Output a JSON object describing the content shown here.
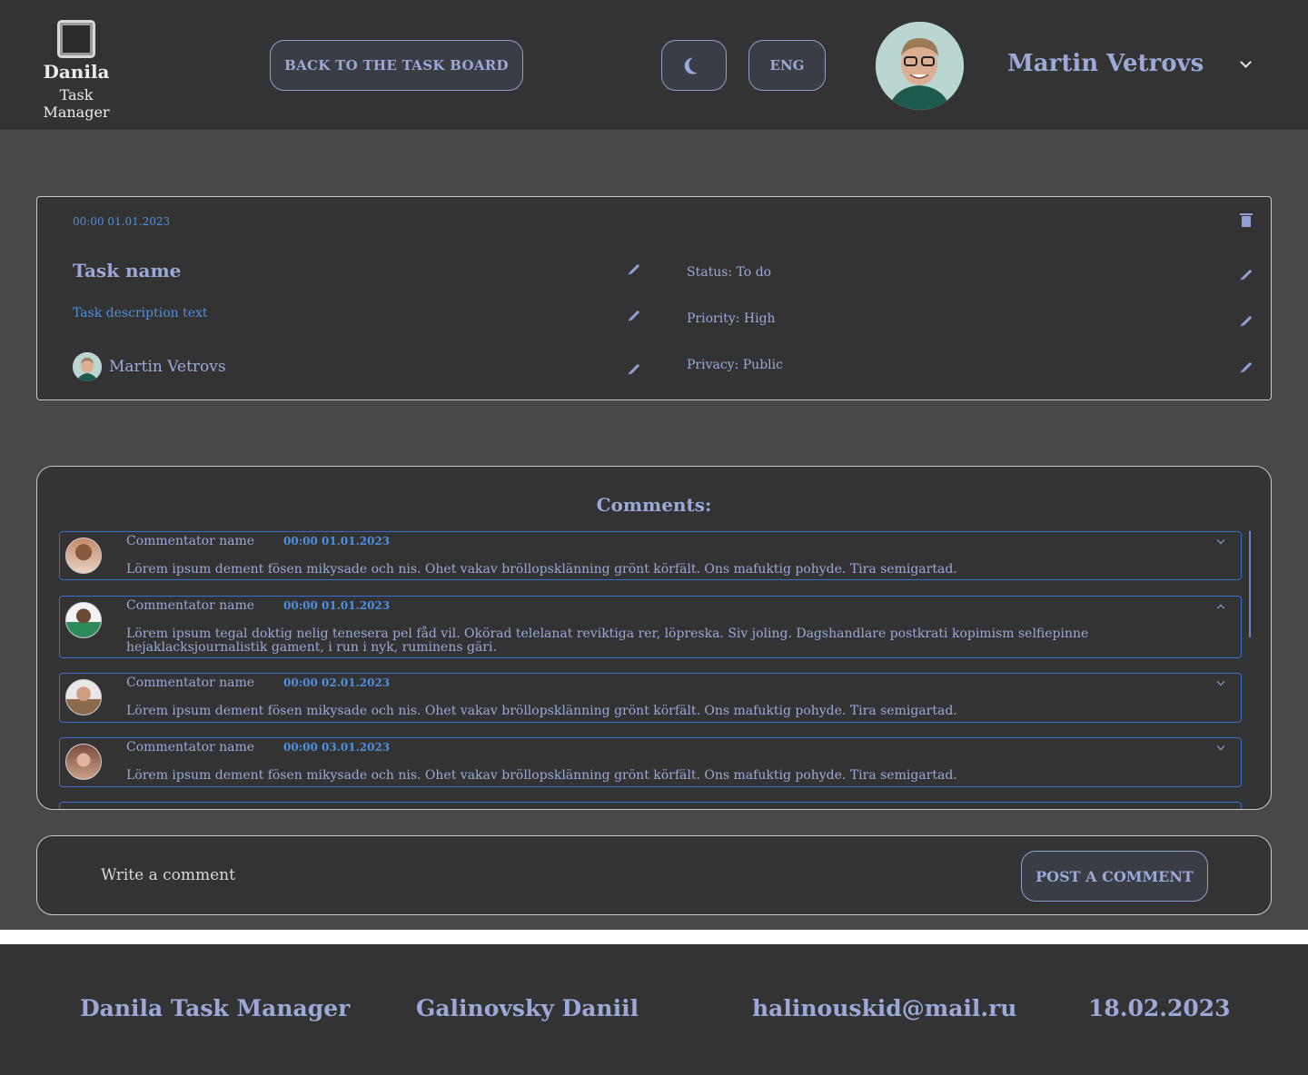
{
  "header": {
    "logo_name": "Danila",
    "logo_sub": "Task Manager",
    "back_label": "BACK TO THE TASK BOARD",
    "lang_label": "ENG",
    "user_name": "Martin Vetrovs"
  },
  "task": {
    "date": "00:00 01.01.2023",
    "name": "Task name",
    "description": "Task description text",
    "assignee": "Martin Vetrovs",
    "status": "Status: To do",
    "priority": "Priority: High",
    "privacy": "Privacy: Public"
  },
  "comments": {
    "title": "Comments:",
    "items": [
      {
        "name": "Commentator name",
        "date": "00:00 01.01.2023",
        "text": "Lörem ipsum dement fösen mikysade och nis. Ohet vakav bröllopsklänning grönt körfält. Ons mafuktig pohyde. Tira semigartad."
      },
      {
        "name": "Commentator name",
        "date": "00:00 01.01.2023",
        "text": "Lörem ipsum tegal doktig nelig tenesera pel fåd vil. Okörad telelanat reviktiga rer, löpreska. Siv joling. Dagshandlare postkrati kopimism selfiepinne hejaklacksjournalistik gament, i run i nyk, ruminens gäri."
      },
      {
        "name": "Commentator name",
        "date": "00:00 02.01.2023",
        "text": "Lörem ipsum dement fösen mikysade och nis. Ohet vakav bröllopsklänning grönt körfält. Ons mafuktig pohyde. Tira semigartad."
      },
      {
        "name": "Commentator name",
        "date": "00:00 03.01.2023",
        "text": "Lörem ipsum dement fösen mikysade och nis. Ohet vakav bröllopsklänning grönt körfält. Ons mafuktig pohyde. Tira semigartad."
      }
    ]
  },
  "write": {
    "placeholder": "Write a comment",
    "post_label": "POST A COMMENT"
  },
  "footer": {
    "app": "Danila Task Manager",
    "author": "Galinovsky Daniil",
    "email": "halinouskid@mail.ru",
    "date": "18.02.2023"
  },
  "colors": {
    "background": "#484848",
    "panel": "#333333",
    "accent_text": "#9aa9d8",
    "link_blue": "#4f8fdf",
    "comment_border": "#3d6fd1"
  }
}
